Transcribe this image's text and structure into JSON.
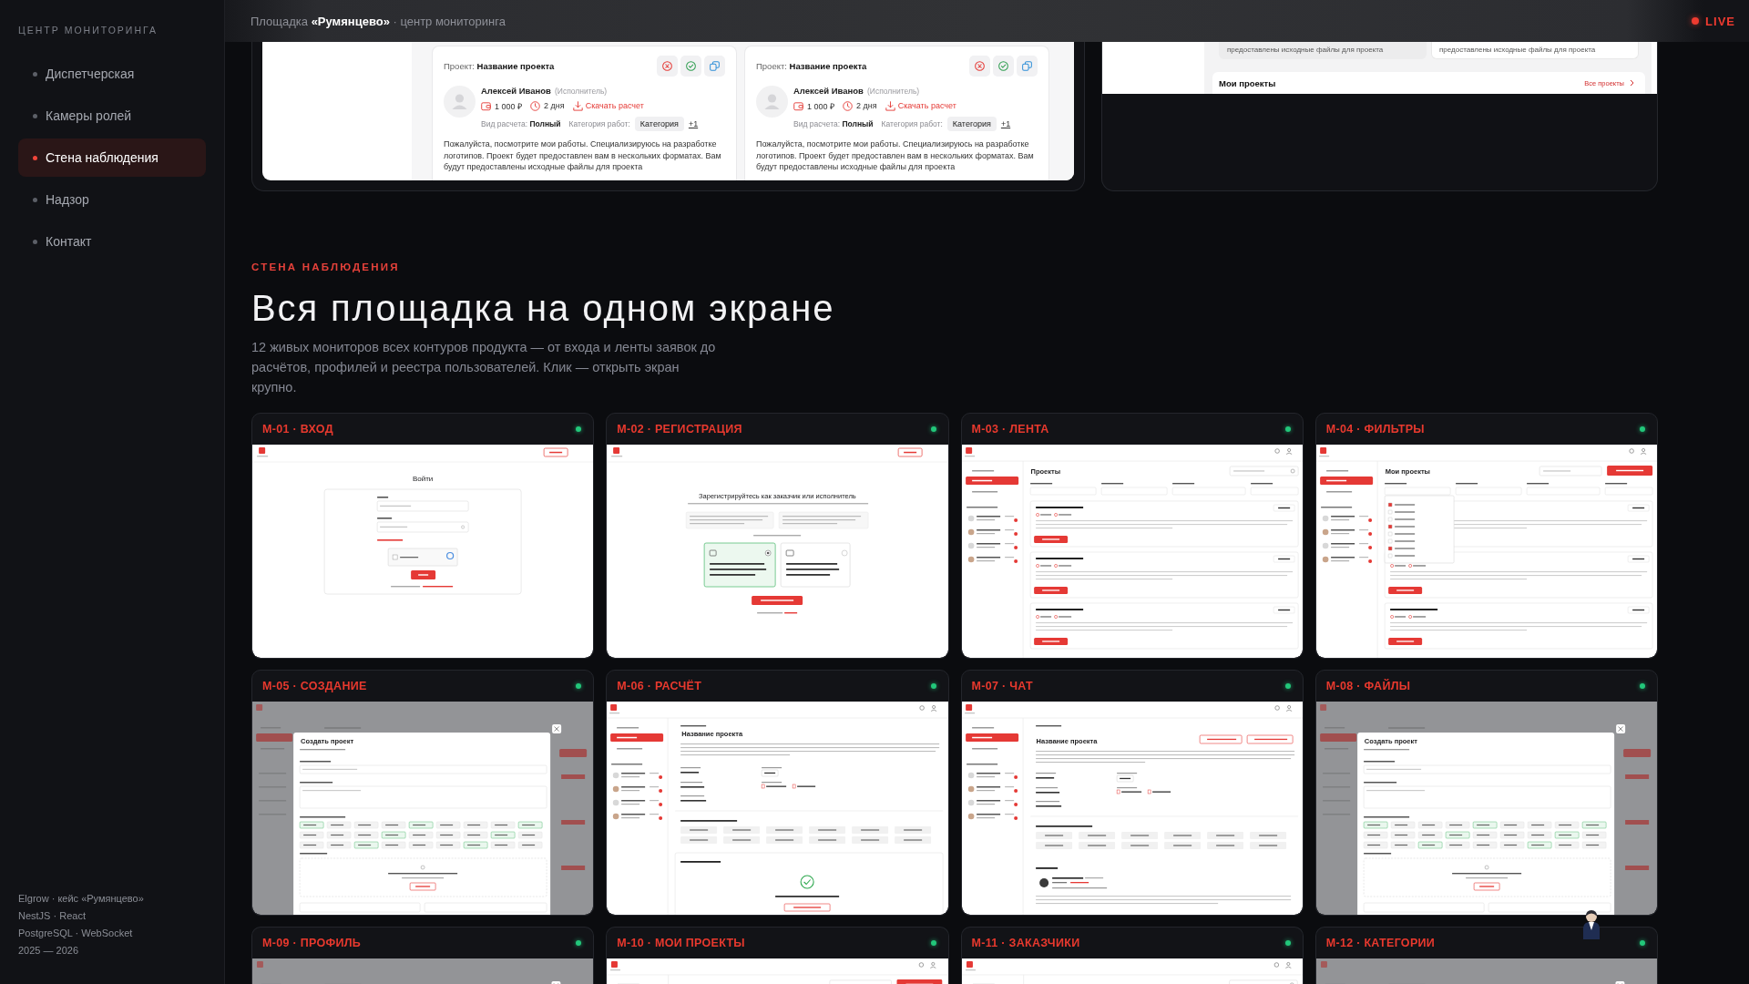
{
  "sidebar": {
    "title": "ЦЕНТР МОНИТОРИНГА",
    "items": [
      {
        "label": "Диспетчерская",
        "selected": false
      },
      {
        "label": "Камеры ролей",
        "selected": false
      },
      {
        "label": "Стена наблюдения",
        "selected": true
      },
      {
        "label": "Надзор",
        "selected": false
      },
      {
        "label": "Контакт",
        "selected": false
      }
    ],
    "footer": [
      "Elgrow · кейс «Румянцево»",
      "NestJS · React",
      "PostgreSQL · WebSocket",
      "2025 — 2026"
    ]
  },
  "topbar": {
    "breadcrumb": "Площадка **«Румянцево»** · центр мониторинга",
    "live": "LIVE"
  },
  "upper_previews": {
    "left": {
      "projects": [
        {
          "title": "Проект: **Название проекта**",
          "person": "Алексей Иванов",
          "role": "(Исполнитель)",
          "price": "1 000 ₽",
          "term": "2 дня",
          "download": "Скачать расчет",
          "calc": "Вид расчета: **Полный**",
          "category_label": "Категория работ:",
          "category": "Категория",
          "more": "+1",
          "text": "Пожалуйста, посмотрите мои работы. Специализируюсь на разработке логотипов. Проект будет предоставлен вам в нескольких форматах. Вам будут предоставлены исходные файлы для проекта"
        },
        {
          "title": "Проект: **Название проекта**",
          "person": "Алексей Иванов",
          "role": "(Исполнитель)",
          "price": "1 000 ₽",
          "term": "2 дня",
          "download": "Скачать расчет",
          "calc": "Вид расчета: **Полный**",
          "category_label": "Категория работ:",
          "category": "Категория",
          "more": "+1",
          "text": "Пожалуйста, посмотрите мои работы. Специализируюсь на разработке логотипов. Проект будет предоставлен вам в нескольких форматах. Вам будут предоставлены исходные файлы для проекта"
        }
      ]
    },
    "right": {
      "excerpts": [
        "предоставлены исходные файлы для проекта",
        "предоставлены исходные файлы для проекта"
      ],
      "section_title": "Мои проекты",
      "link": "Все проекты"
    }
  },
  "section": {
    "eyebrow": "СТЕНА НАБЛЮДЕНИЯ",
    "title": "Вся площадка на одном экране",
    "text": "12 живых мониторов всех контуров продукта — от входа и ленты заявок до расчётов, профилей и реестра пользователей. Клик — открыть экран крупно."
  },
  "monitors": [
    {
      "label": "M-01 · ВХОД",
      "kind": "login",
      "online": true,
      "screen_title": "Войти"
    },
    {
      "label": "M-02 · РЕГИСТРАЦИЯ",
      "kind": "register",
      "online": true,
      "screen_title": "Зарегистрируйтесь как заказчик или исполнитель"
    },
    {
      "label": "M-03 · ЛЕНТА",
      "kind": "feed",
      "online": true,
      "screen_title": "Проекты"
    },
    {
      "label": "M-04 · ФИЛЬТРЫ",
      "kind": "projects",
      "online": true,
      "screen_title": "Мои проекты"
    },
    {
      "label": "M-05 · СОЗДАНИЕ",
      "kind": "modal",
      "online": true,
      "screen_title": "Создать проект"
    },
    {
      "label": "M-06 · РАСЧЁТ",
      "kind": "calc",
      "online": true,
      "screen_title": "Название проекта"
    },
    {
      "label": "M-07 · ЧАТ",
      "kind": "chat",
      "online": true,
      "screen_title": "Название проекта"
    },
    {
      "label": "M-08 · ФАЙЛЫ",
      "kind": "modal",
      "online": true,
      "screen_title": "Создать проект"
    },
    {
      "label": "M-09 · ПРОФИЛЬ",
      "kind": "modal",
      "online": true
    },
    {
      "label": "M-10 · МОИ ПРОЕКТЫ",
      "kind": "projects",
      "online": true
    },
    {
      "label": "M-11 · ЗАКАЗЧИКИ",
      "kind": "feed",
      "online": true
    },
    {
      "label": "M-12 · КАТЕГОРИИ",
      "kind": "modal",
      "online": true
    }
  ]
}
